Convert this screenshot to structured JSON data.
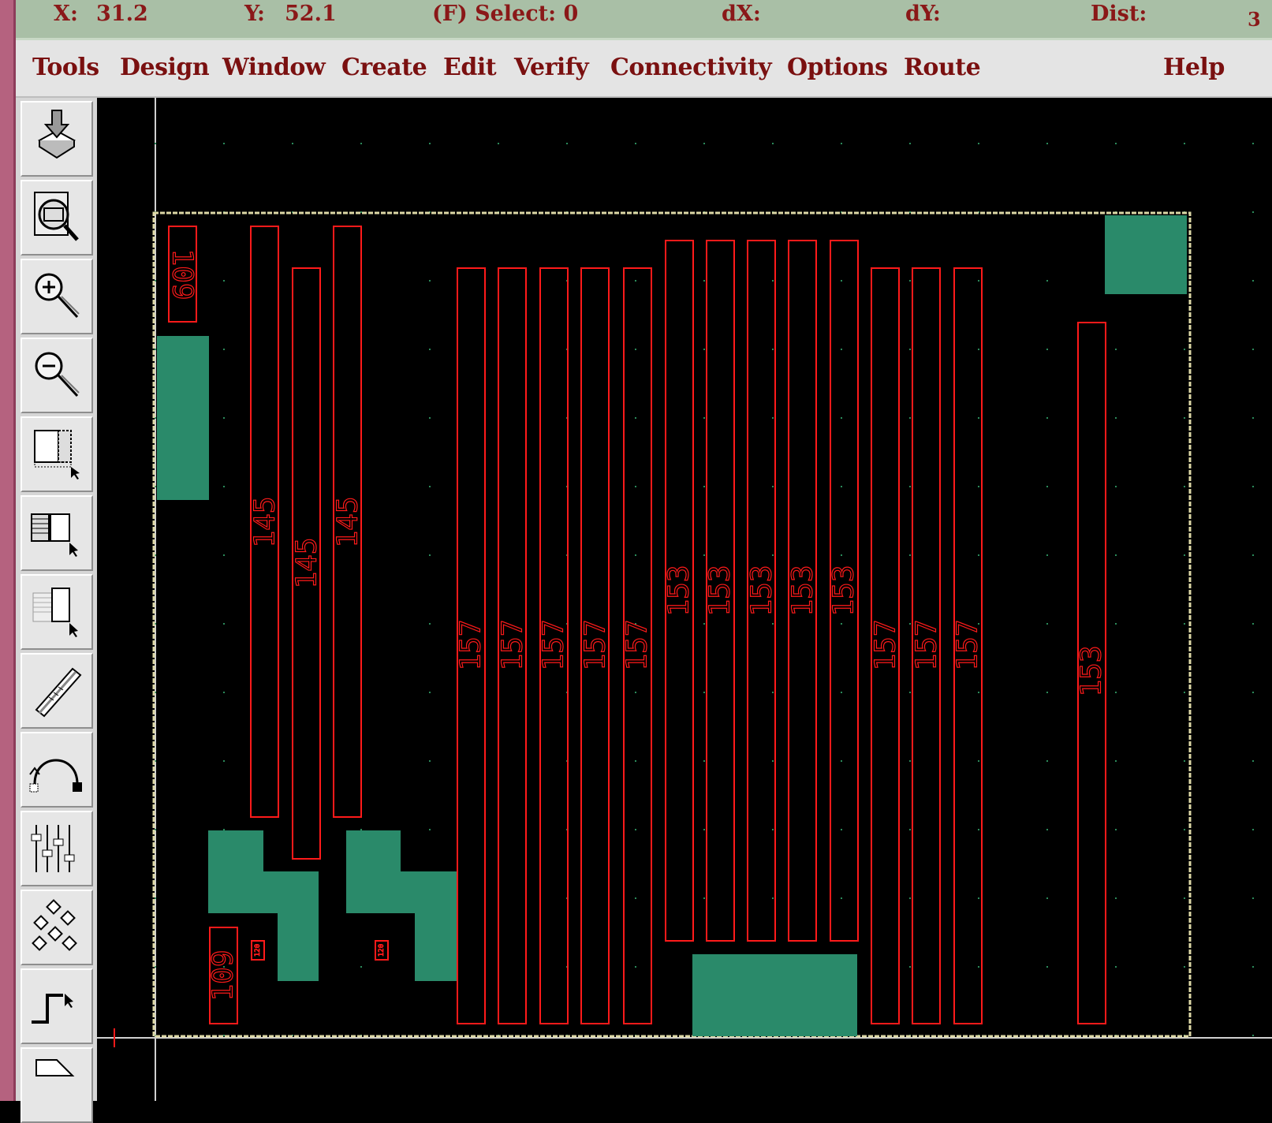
{
  "status": {
    "x_label": "X:",
    "x_value": "31.2",
    "y_label": "Y:",
    "y_value": "52.1",
    "select": "(F) Select: 0",
    "dx_label": "dX:",
    "dy_label": "dY:",
    "dist_label": "Dist:",
    "cut_value": "3"
  },
  "menu": [
    "Tools",
    "Design",
    "Window",
    "Create",
    "Edit",
    "Verify",
    "Connectivity",
    "Options",
    "Route",
    "Help"
  ],
  "toolbar": [
    "save-icon",
    "fit-view-icon",
    "zoom-in-icon",
    "zoom-out-icon",
    "select-area-icon",
    "select-multiple-icon",
    "select-partial-icon",
    "ruler-icon",
    "arc-icon",
    "align-icon",
    "connect-icon",
    "path-icon",
    "polygon-icon"
  ],
  "layout": {
    "labels": {
      "left_top": "109",
      "col_a": "145",
      "col_b": "145",
      "col_c": "145",
      "g1": [
        "157",
        "157",
        "157",
        "157",
        "157"
      ],
      "g2": [
        "153",
        "153",
        "153",
        "153",
        "153"
      ],
      "g3": [
        "157",
        "157",
        "157"
      ],
      "right": "153",
      "left_bottom": "109",
      "tiny1": "120",
      "tiny2": "120"
    }
  },
  "colors": {
    "shape_outline": "#ff1a1a",
    "fill_block": "#2a8a6a",
    "boundary": "#e6e0a0",
    "status_bg": "#a9bfa6",
    "menu_text": "#7a1010",
    "status_text": "#8a1818"
  }
}
